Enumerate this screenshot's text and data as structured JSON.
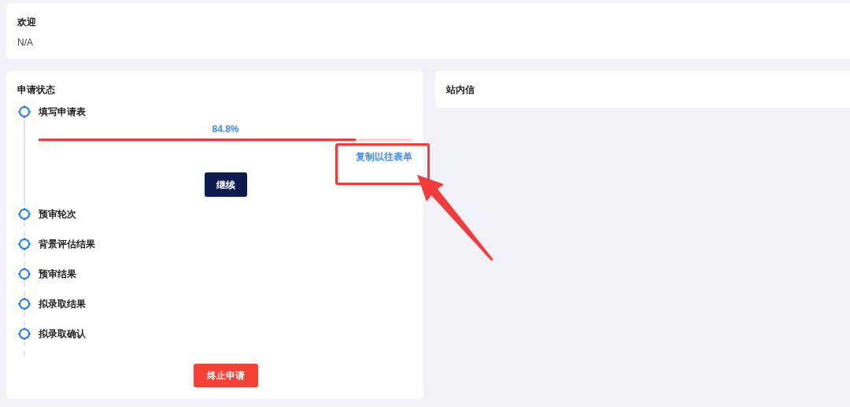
{
  "welcome": {
    "title": "欢迎",
    "value": "N/A"
  },
  "application_status": {
    "title": "申请状态",
    "steps": [
      {
        "label": "填写申请表",
        "progress": {
          "label": "84.8%",
          "level": 0.848
        },
        "link": "复制以往表单",
        "button": "继续"
      },
      {
        "label": "预审轮次"
      },
      {
        "label": "背景评估结果"
      },
      {
        "label": "预审结果"
      },
      {
        "label": "拟录取结果"
      },
      {
        "label": "拟录取确认"
      }
    ],
    "button": "终止申请"
  },
  "messages": {
    "title": "站内信"
  }
}
